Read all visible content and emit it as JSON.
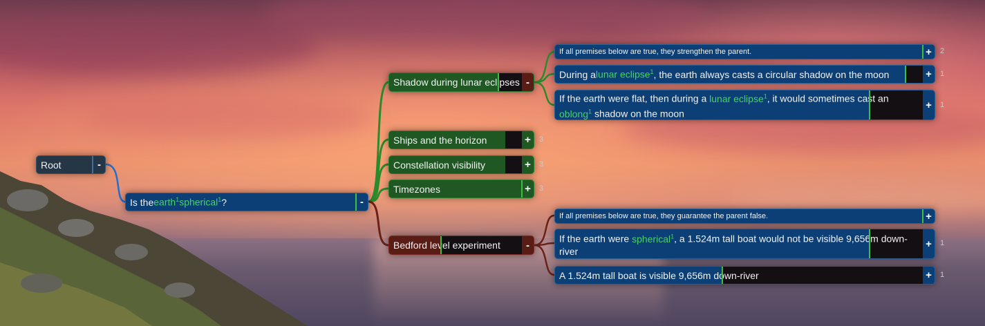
{
  "root": {
    "label": "Root",
    "toggle": "-"
  },
  "question": {
    "prefix": "Is the ",
    "kw1": "earth",
    "sup1": "1",
    "sp": " ",
    "kw2": "spherical",
    "sup2": "1",
    "suffix": "?",
    "toggle": "-"
  },
  "support": [
    {
      "label": "Shadow during lunar eclipses",
      "toggle": "-"
    },
    {
      "label": "Ships and the horizon",
      "toggle": "+",
      "count": "3"
    },
    {
      "label": "Constellation visibility",
      "toggle": "+",
      "count": "3"
    },
    {
      "label": "Timezones",
      "toggle": "+",
      "count": "3"
    }
  ],
  "oppose": {
    "label": "Bedford level experiment",
    "toggle": "-"
  },
  "shadow_children": {
    "header": {
      "label": "If all premises below are true, they strengthen the parent.",
      "toggle": "+",
      "count": "2"
    },
    "premise1": {
      "prefix": "During a ",
      "kw": "lunar eclipse",
      "sup": "1",
      "suffix": ", the earth always casts a circular shadow on the moon",
      "toggle": "+",
      "count": "1"
    },
    "premise2": {
      "prefix": "If the earth were flat, then during a ",
      "kw": "lunar eclipse",
      "sup": "1",
      "mid": ", it would sometimes cast an ",
      "kw2": "oblong",
      "sup2": "1",
      "suffix": " shadow on the moon",
      "toggle": "+",
      "count": "1"
    }
  },
  "bedford_children": {
    "header": {
      "label": "If all premises below are true, they guarantee the parent false.",
      "toggle": "+"
    },
    "premise1": {
      "prefix": "If the earth were ",
      "kw": "spherical",
      "sup": "1",
      "suffix": ", a 1.524m tall boat would not be visible 9,656m down-river",
      "toggle": "+",
      "count": "1"
    },
    "premise2": {
      "label": "A 1.524m tall boat is visible 9,656m down-river",
      "toggle": "+",
      "count": "1"
    }
  },
  "colors": {
    "blue": "#0b3f76",
    "green": "#1f5823",
    "red": "#5a1d15",
    "keyword": "#46d364",
    "support_line": "#2c8a2c",
    "oppose_line": "#6a2218",
    "root_line": "#1f6fd0"
  }
}
